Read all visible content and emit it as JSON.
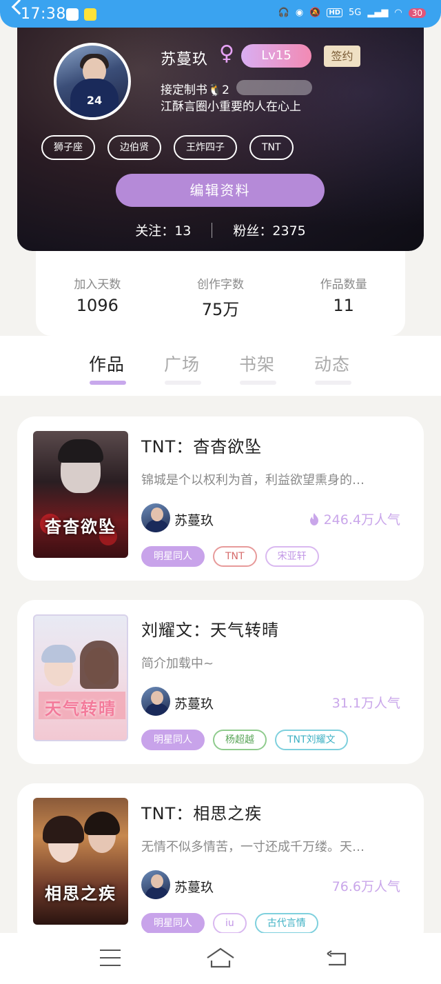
{
  "status_bar": {
    "time": "17:38",
    "hd_label": "HD",
    "network_label": "5G",
    "battery_level": "30"
  },
  "profile": {
    "name": "苏蔓玖",
    "gender_icon": "female-symbol-icon",
    "level": "Lv15",
    "sign_badge": "签约",
    "bio_line1": "接定制书🐧2",
    "bio_line2": "江酥言圈小重要的人在心上",
    "tags": [
      "狮子座",
      "边伯贤",
      "王炸四子",
      "TNT"
    ],
    "edit_button": "编辑资料",
    "following": "关注：13",
    "followers": "粉丝：2375"
  },
  "stats": [
    {
      "label": "加入天数",
      "value": "1096"
    },
    {
      "label": "创作字数",
      "value": "75万"
    },
    {
      "label": "作品数量",
      "value": "11"
    }
  ],
  "tabs": [
    {
      "label": "作品",
      "active": true
    },
    {
      "label": "广场",
      "active": false
    },
    {
      "label": "书架",
      "active": false
    },
    {
      "label": "动态",
      "active": false
    }
  ],
  "books": [
    {
      "title": "TNT：杳杳欲坠",
      "cover_text": "杳杳欲坠",
      "description": "锦城是个以权利为首，利益欲望熏身的…",
      "author": "苏蔓玖",
      "popularity": "246.4万人气",
      "show_flame": true,
      "tags": [
        {
          "label": "明星同人",
          "style": "filled"
        },
        {
          "label": "TNT",
          "style": "red"
        },
        {
          "label": "宋亚轩",
          "style": "violet"
        }
      ]
    },
    {
      "title": "刘耀文：天气转晴",
      "cover_text": "天气转晴",
      "description": "简介加载中~",
      "author": "苏蔓玖",
      "popularity": "31.1万人气",
      "show_flame": false,
      "tags": [
        {
          "label": "明星同人",
          "style": "filled"
        },
        {
          "label": "杨超越",
          "style": "green"
        },
        {
          "label": "TNT刘耀文",
          "style": "cyan"
        }
      ]
    },
    {
      "title": "TNT：相思之疾",
      "cover_text": "相思之疾",
      "description": "无情不似多情苦，一寸还成千万缕。天…",
      "author": "苏蔓玖",
      "popularity": "76.6万人气",
      "show_flame": false,
      "tags": [
        {
          "label": "明星同人",
          "style": "filled"
        },
        {
          "label": "iu",
          "style": "violet"
        },
        {
          "label": "古代言情",
          "style": "cyan"
        }
      ]
    }
  ],
  "colors": {
    "accent": "#b58ad8",
    "popularity": "#c9a6ea",
    "status_bar": "#3aa3f0"
  }
}
